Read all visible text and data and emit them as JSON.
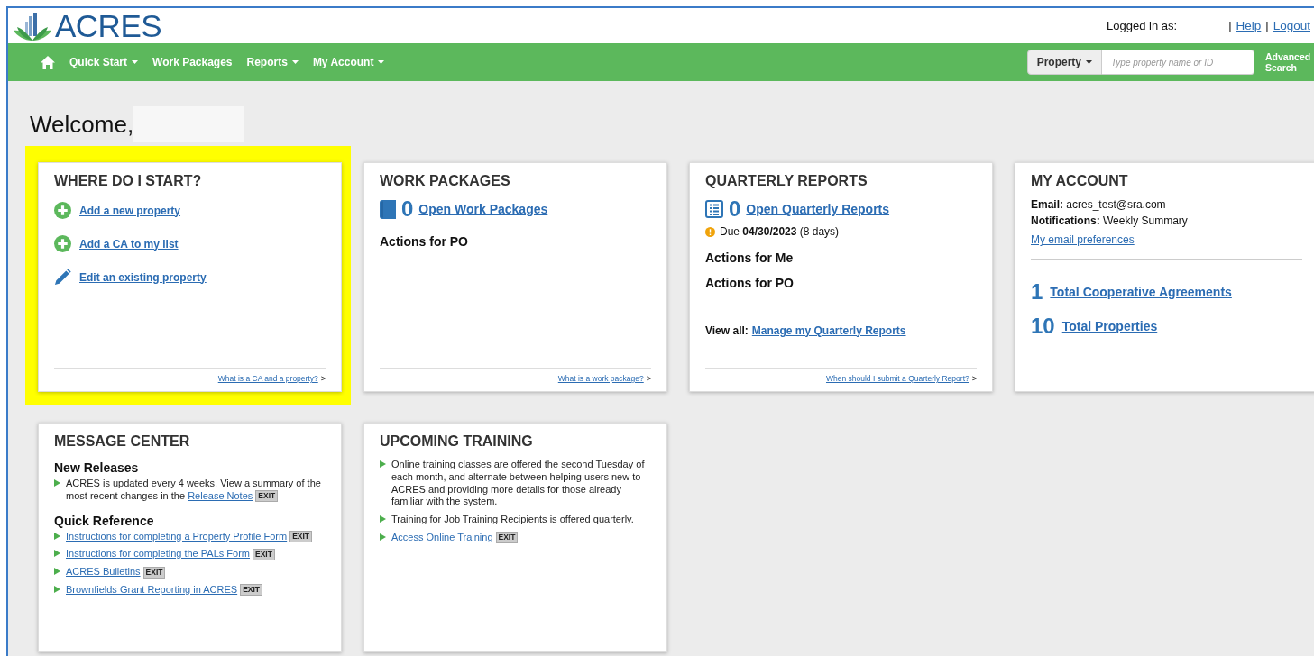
{
  "header": {
    "logo_text": "ACRES",
    "logged_in_label": "Logged in as:",
    "links": [
      {
        "separator": "|",
        "label": "Help"
      },
      {
        "separator": "|",
        "label": "Logout"
      }
    ]
  },
  "nav": {
    "items": [
      {
        "label": "Quick Start",
        "dropdown": true
      },
      {
        "label": "Work Packages",
        "dropdown": false
      },
      {
        "label": "Reports",
        "dropdown": true
      },
      {
        "label": "My Account",
        "dropdown": true
      }
    ],
    "search": {
      "scope": "Property",
      "placeholder": "Type property name or ID"
    },
    "advanced_search": "Advanced Search"
  },
  "welcome": "Welcome,",
  "cards": [
    {
      "kind": "start",
      "title": "WHERE DO I START?",
      "highlighted": true,
      "links": [
        {
          "kind": "add",
          "label": "Add a new property"
        },
        {
          "kind": "add",
          "label": "Add a CA to my list"
        },
        {
          "kind": "edit",
          "label": "Edit an existing property"
        }
      ],
      "footer_link": "What is a CA and a property?",
      "footer_mark": ">"
    },
    {
      "kind": "work",
      "title": "WORK PACKAGES",
      "highlighted": false,
      "count": "0",
      "count_link": "Open Work Packages",
      "sections": [
        "Actions for PO"
      ],
      "footer_link": "What is a work package?",
      "footer_mark": ">"
    },
    {
      "kind": "quarterly",
      "title": "QUARTERLY REPORTS",
      "highlighted": false,
      "count": "0",
      "count_link": "Open Quarterly Reports",
      "due": "Due **04/30/2023** (8 days)",
      "sections": [
        "Actions for Me",
        "Actions for PO"
      ],
      "view_all_label": "View all:",
      "view_all_link": "Manage my Quarterly Reports",
      "footer_link": "When should I submit a Quarterly Report?",
      "footer_mark": ">"
    },
    {
      "kind": "account",
      "title": "MY ACCOUNT",
      "highlighted": false,
      "details": [
        "**Email:** acres_test@sra.com",
        "**Notifications:** Weekly Summary"
      ],
      "preferences_link": "My email preferences",
      "totals": [
        {
          "count": "1",
          "label": "Total Cooperative Agreements"
        },
        {
          "count": "10",
          "label": "Total Properties"
        }
      ]
    },
    {
      "kind": "messages",
      "title": "MESSAGE CENTER",
      "highlighted": false,
      "groups": [
        {
          "heading": "New Releases",
          "items": [
            {
              "text": "ACRES is updated every 4 weeks. View a summary of the most recent changes in the",
              "link": "Release Notes",
              "badge": "EXIT"
            }
          ]
        },
        {
          "heading": "Quick Reference",
          "items": [
            {
              "link": "Instructions for completing a Property Profile Form",
              "badge": "EXIT"
            },
            {
              "link": "Instructions for completing the PALs Form",
              "badge": "EXIT"
            },
            {
              "link": "ACRES Bulletins",
              "badge": "EXIT"
            },
            {
              "link": "Brownfields Grant Reporting in ACRES",
              "badge": "EXIT"
            }
          ]
        }
      ]
    },
    {
      "kind": "training",
      "title": "UPCOMING TRAINING",
      "highlighted": false,
      "groups": [
        {
          "items": [
            {
              "text": "Online training classes are offered the second Tuesday of each month, and alternate between helping users new to ACRES and providing more details for those already familiar with the system."
            },
            {
              "text": "Training for Job Training Recipients is offered quarterly."
            },
            {
              "link": "Access Online Training",
              "badge": "EXIT"
            }
          ]
        }
      ]
    }
  ]
}
